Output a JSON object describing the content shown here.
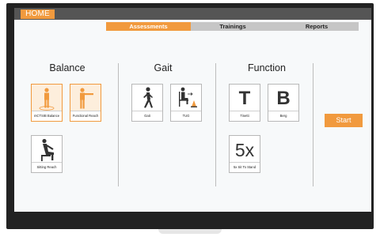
{
  "header": {
    "home_label": "HOME"
  },
  "tabs": [
    {
      "label": "Assessments",
      "active": true
    },
    {
      "label": "Trainings",
      "active": false
    },
    {
      "label": "Reports",
      "active": false
    }
  ],
  "sections": {
    "balance": {
      "title": "Balance",
      "cards": [
        {
          "label": "mCTSIB Balance",
          "icon": "standing-person-icon",
          "selected": true
        },
        {
          "label": "Functional Reach",
          "icon": "reaching-person-icon",
          "selected": true
        },
        {
          "label": "Sitting Reach",
          "icon": "seated-person-icon",
          "selected": false
        }
      ]
    },
    "gait": {
      "title": "Gait",
      "cards": [
        {
          "label": "Gait",
          "icon": "walking-person-icon"
        },
        {
          "label": "TUG",
          "icon": "sit-walk-cone-icon"
        }
      ]
    },
    "function": {
      "title": "Function",
      "cards": [
        {
          "label": "Tinetti",
          "glyph": "T"
        },
        {
          "label": "Berg",
          "glyph": "B"
        },
        {
          "label": "5x Sit To Stand",
          "glyph": "5x"
        }
      ]
    }
  },
  "actions": {
    "start_label": "Start"
  },
  "colors": {
    "accent": "#f19a3e",
    "topbar": "#555555",
    "tab_inactive": "#c6c6c6",
    "bezel": "#222222",
    "screen_bg": "#f7f9fa"
  }
}
